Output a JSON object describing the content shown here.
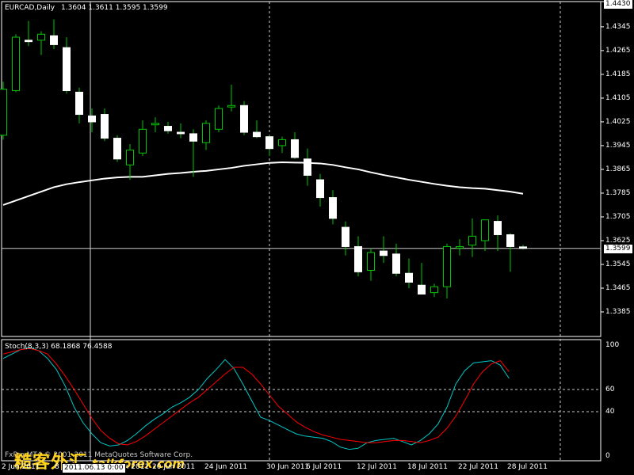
{
  "header": {
    "symbol": "EURCAD,Daily",
    "ohlc": "1.3604 1.3611 1.3595 1.3599"
  },
  "colors": {
    "background": "#000000",
    "frame": "#ffffff",
    "bull": "#00c800",
    "bear": "#ffffff",
    "ma": "#ffffff",
    "stoch_main": "#00c8c8",
    "stoch_signal": "#ff0000",
    "watermark": "#ffd21e"
  },
  "price_axis": {
    "ticks": [
      "1.4430",
      "1.4345",
      "1.4265",
      "1.4185",
      "1.4105",
      "1.4025",
      "1.3945",
      "1.3865",
      "1.3785",
      "1.3705",
      "1.3625",
      "1.3545",
      "1.3465",
      "1.3385"
    ],
    "current": "1.3599"
  },
  "date_labels": [
    "2 Jun 2011",
    "8 Jun 2011",
    "14 Jun 2011",
    "20 Jun 2011",
    "24 Jun 2011",
    "30 Jun 2011",
    "6 Jul 2011",
    "12 Jul 2011",
    "18 Jul 2011",
    "22 Jul 2011",
    "28 Jul 2011"
  ],
  "cursor_date": "2011.06.13 0:00",
  "indicator": {
    "label": "Stoch(8,3,3) 68.1868 76.4588",
    "levels": [
      "100",
      "60",
      "40",
      "0"
    ]
  },
  "copyright": "FxPro MT4 © 2001-2011 MetaQuotes Software Corp.",
  "watermark": {
    "cn": "糙客外汇",
    "url": "talkforex.com"
  },
  "chart_data": [
    {
      "type": "candlestick",
      "title": "EURCAD,Daily",
      "ylim": [
        1.3385,
        1.443
      ],
      "grid": false,
      "candles": [
        {
          "o": 1.398,
          "h": 1.416,
          "l": 1.3965,
          "c": 1.4135
        },
        {
          "o": 1.413,
          "h": 1.432,
          "l": 1.4125,
          "c": 1.431
        },
        {
          "o": 1.43,
          "h": 1.4365,
          "l": 1.428,
          "c": 1.4295
        },
        {
          "o": 1.43,
          "h": 1.433,
          "l": 1.425,
          "c": 1.432
        },
        {
          "o": 1.4315,
          "h": 1.437,
          "l": 1.427,
          "c": 1.4285
        },
        {
          "o": 1.4275,
          "h": 1.431,
          "l": 1.412,
          "c": 1.413
        },
        {
          "o": 1.4125,
          "h": 1.414,
          "l": 1.402,
          "c": 1.405
        },
        {
          "o": 1.4045,
          "h": 1.407,
          "l": 1.399,
          "c": 1.4025
        },
        {
          "o": 1.405,
          "h": 1.407,
          "l": 1.396,
          "c": 1.397
        },
        {
          "o": 1.397,
          "h": 1.398,
          "l": 1.389,
          "c": 1.39
        },
        {
          "o": 1.388,
          "h": 1.395,
          "l": 1.383,
          "c": 1.393
        },
        {
          "o": 1.392,
          "h": 1.403,
          "l": 1.391,
          "c": 1.4
        },
        {
          "o": 1.4015,
          "h": 1.404,
          "l": 1.399,
          "c": 1.402
        },
        {
          "o": 1.401,
          "h": 1.4025,
          "l": 1.3985,
          "c": 1.3995
        },
        {
          "o": 1.399,
          "h": 1.402,
          "l": 1.397,
          "c": 1.3985
        },
        {
          "o": 1.3985,
          "h": 1.4,
          "l": 1.384,
          "c": 1.396
        },
        {
          "o": 1.3955,
          "h": 1.403,
          "l": 1.393,
          "c": 1.402
        },
        {
          "o": 1.4,
          "h": 1.408,
          "l": 1.399,
          "c": 1.407
        },
        {
          "o": 1.4075,
          "h": 1.415,
          "l": 1.406,
          "c": 1.408
        },
        {
          "o": 1.408,
          "h": 1.4095,
          "l": 1.398,
          "c": 1.399
        },
        {
          "o": 1.399,
          "h": 1.403,
          "l": 1.397,
          "c": 1.3975
        },
        {
          "o": 1.3975,
          "h": 1.398,
          "l": 1.391,
          "c": 1.3935
        },
        {
          "o": 1.3945,
          "h": 1.3975,
          "l": 1.392,
          "c": 1.3965
        },
        {
          "o": 1.3965,
          "h": 1.399,
          "l": 1.39,
          "c": 1.3905
        },
        {
          "o": 1.39,
          "h": 1.3935,
          "l": 1.381,
          "c": 1.3845
        },
        {
          "o": 1.383,
          "h": 1.385,
          "l": 1.374,
          "c": 1.377
        },
        {
          "o": 1.377,
          "h": 1.3795,
          "l": 1.368,
          "c": 1.37
        },
        {
          "o": 1.367,
          "h": 1.369,
          "l": 1.3575,
          "c": 1.3605
        },
        {
          "o": 1.3605,
          "h": 1.364,
          "l": 1.3505,
          "c": 1.352
        },
        {
          "o": 1.3525,
          "h": 1.36,
          "l": 1.349,
          "c": 1.3585
        },
        {
          "o": 1.359,
          "h": 1.364,
          "l": 1.355,
          "c": 1.3575
        },
        {
          "o": 1.358,
          "h": 1.3615,
          "l": 1.3505,
          "c": 1.3515
        },
        {
          "o": 1.3515,
          "h": 1.3565,
          "l": 1.3465,
          "c": 1.3485
        },
        {
          "o": 1.3475,
          "h": 1.355,
          "l": 1.345,
          "c": 1.3445
        },
        {
          "o": 1.345,
          "h": 1.348,
          "l": 1.3435,
          "c": 1.347
        },
        {
          "o": 1.347,
          "h": 1.3615,
          "l": 1.343,
          "c": 1.3605
        },
        {
          "o": 1.36,
          "h": 1.363,
          "l": 1.3575,
          "c": 1.3605
        },
        {
          "o": 1.361,
          "h": 1.37,
          "l": 1.357,
          "c": 1.364
        },
        {
          "o": 1.3625,
          "h": 1.369,
          "l": 1.359,
          "c": 1.3695
        },
        {
          "o": 1.369,
          "h": 1.371,
          "l": 1.359,
          "c": 1.3645
        },
        {
          "o": 1.3645,
          "h": 1.365,
          "l": 1.352,
          "c": 1.3605
        },
        {
          "o": 1.3604,
          "h": 1.3611,
          "l": 1.3595,
          "c": 1.3599
        }
      ],
      "moving_average": [
        1.3745,
        1.376,
        1.3775,
        1.379,
        1.3805,
        1.3815,
        1.3822,
        1.3828,
        1.3834,
        1.3838,
        1.384,
        1.384,
        1.3845,
        1.385,
        1.3853,
        1.3857,
        1.386,
        1.3865,
        1.387,
        1.3877,
        1.3882,
        1.3887,
        1.3889,
        1.3888,
        1.3887,
        1.3885,
        1.388,
        1.3872,
        1.3865,
        1.3855,
        1.3846,
        1.3838,
        1.383,
        1.3823,
        1.3816,
        1.381,
        1.3805,
        1.3802,
        1.38,
        1.3795,
        1.379,
        1.3783
      ],
      "x_tick_labels": [
        "2 Jun 2011",
        "8 Jun 2011",
        "14 Jun 2011",
        "20 Jun 2011",
        "24 Jun 2011",
        "30 Jun 2011",
        "6 Jul 2011",
        "12 Jul 2011",
        "18 Jul 2011",
        "22 Jul 2011",
        "28 Jul 2011"
      ],
      "y_tick_labels": [
        "1.4430",
        "1.4345",
        "1.4265",
        "1.4185",
        "1.4105",
        "1.4025",
        "1.3945",
        "1.3865",
        "1.3785",
        "1.3705",
        "1.3625",
        "1.3545",
        "1.3465",
        "1.3385"
      ]
    },
    {
      "type": "line",
      "title": "Stoch(8,3,3) 68.1868 76.4588",
      "ylim": [
        0,
        100
      ],
      "levels": [
        60,
        40
      ],
      "series": [
        {
          "values": [
            88,
            92,
            96,
            98,
            95,
            88,
            78,
            63,
            44,
            30,
            20,
            12,
            9,
            10,
            14,
            20,
            27,
            33,
            38,
            44,
            48,
            53,
            60,
            70,
            78,
            87,
            79,
            65,
            50,
            35,
            32,
            28,
            24,
            20,
            18,
            17,
            16,
            13,
            8,
            6,
            7,
            12,
            14,
            15,
            16,
            13,
            10,
            14,
            20,
            29,
            44,
            65,
            77,
            84,
            85,
            86,
            82,
            70
          ]
        },
        {
          "values": [
            92,
            94,
            96,
            97,
            95,
            92,
            83,
            72,
            60,
            47,
            34,
            23,
            16,
            11,
            10,
            13,
            18,
            24,
            30,
            36,
            42,
            48,
            53,
            60,
            67,
            74,
            80,
            80,
            74,
            65,
            55,
            45,
            38,
            31,
            26,
            22,
            19,
            17,
            15,
            14,
            13,
            12,
            12,
            13,
            14,
            14,
            13,
            12,
            14,
            17,
            25,
            36,
            50,
            65,
            76,
            83,
            86,
            76
          ]
        }
      ],
      "y_tick_labels": [
        "100",
        "60",
        "40",
        "0"
      ]
    }
  ]
}
